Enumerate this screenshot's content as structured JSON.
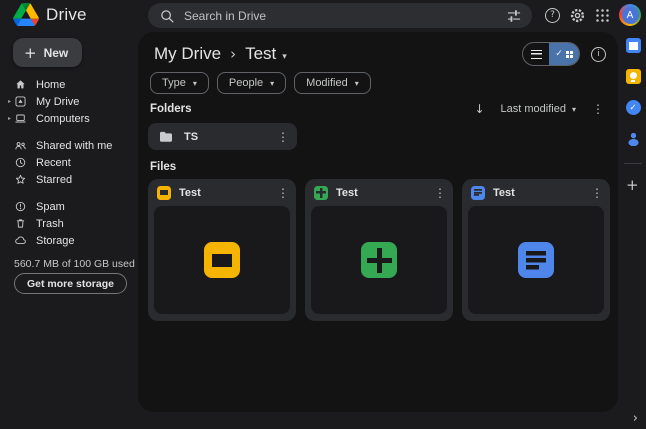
{
  "app": {
    "name": "Drive"
  },
  "account": {
    "initial": "A"
  },
  "search": {
    "placeholder": "Search in Drive"
  },
  "glyphs": {
    "plus": "+",
    "more_vertical": "⋮",
    "caret_down": "▾",
    "arrow_down": "↓",
    "check": "✓",
    "chevron_separator": "›",
    "chevron_right": "›",
    "help": "?",
    "info": "i",
    "expander": "▸"
  },
  "sidebar": {
    "new_label": "New",
    "items": [
      {
        "label": "Home"
      },
      {
        "label": "My Drive"
      },
      {
        "label": "Computers"
      },
      {
        "label": "Shared with me"
      },
      {
        "label": "Recent"
      },
      {
        "label": "Starred"
      },
      {
        "label": "Spam"
      },
      {
        "label": "Trash"
      },
      {
        "label": "Storage"
      }
    ],
    "storage_text": "560.7 MB of 100 GB used",
    "storage_button": "Get more storage"
  },
  "main": {
    "breadcrumb": {
      "root": "My Drive",
      "current": "Test"
    },
    "filters": [
      {
        "label": "Type"
      },
      {
        "label": "People"
      },
      {
        "label": "Modified"
      }
    ],
    "folders_label": "Folders",
    "files_label": "Files",
    "sort_label": "Last modified",
    "folders": [
      {
        "name": "TS"
      }
    ],
    "files": [
      {
        "name": "Test",
        "type": "slides"
      },
      {
        "name": "Test",
        "type": "sheets"
      },
      {
        "name": "Test",
        "type": "docs"
      }
    ]
  },
  "colors": {
    "bg-outer": "#1B1B1D",
    "bg-panel": "#131314",
    "bg-raised": "#2A2B2E",
    "bg-preview": "#19191B",
    "bg-search": "#2D2E31",
    "bg-new": "#3B3C3F",
    "text-primary": "#E3E3E3",
    "text-secondary": "#C4C7C5",
    "toggle-blue": "#4A73A9",
    "slides": "#F4B400",
    "sheets": "#34A853",
    "docs": "#4E86EC",
    "keep": "#F5B400",
    "gblue": "#4285F4",
    "avatar": "#4A74D9"
  }
}
